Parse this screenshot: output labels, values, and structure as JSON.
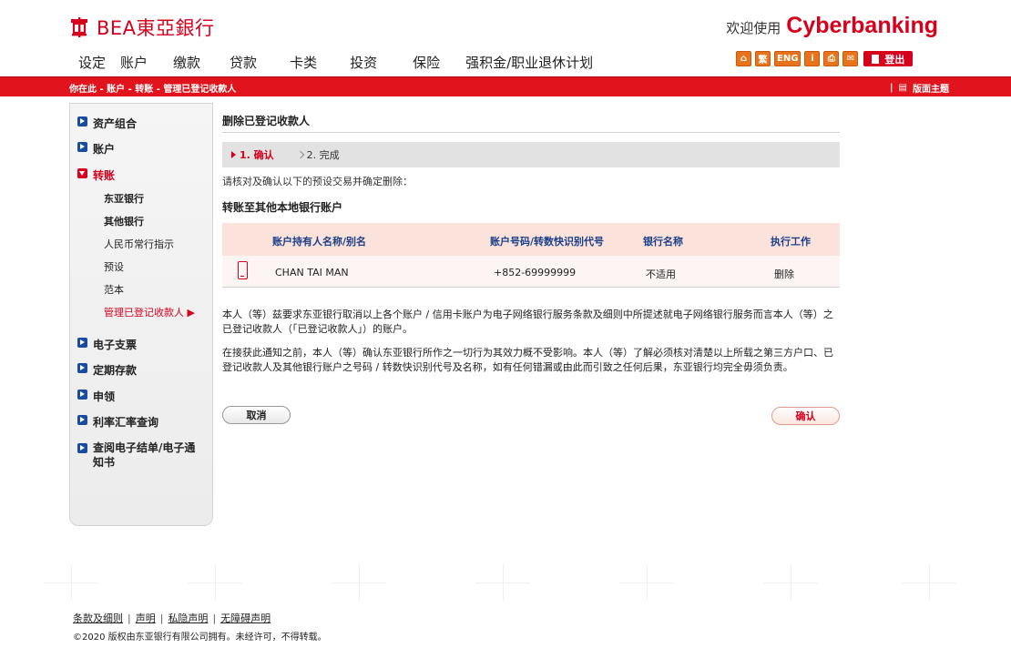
{
  "header": {
    "logo_text": "BEA東亞銀行",
    "welcome": "欢迎使用",
    "brand": "Cyberbanking"
  },
  "topnav": [
    "设定",
    "账户",
    "缴款",
    "贷款",
    "卡类",
    "投资",
    "保险",
    "强积金/职业退休计划"
  ],
  "tool_icons": [
    {
      "name": "home-icon",
      "label": "⌂"
    },
    {
      "name": "traditional-chinese-icon",
      "label": "繁"
    },
    {
      "name": "english-icon",
      "label": "ENG"
    },
    {
      "name": "info-icon",
      "label": "i"
    },
    {
      "name": "print-icon",
      "label": "⎙"
    },
    {
      "name": "mail-icon",
      "label": "✉"
    }
  ],
  "logout_label": "登出",
  "breadcrumb": "你在此 - 账户 - 转账 - 管理已登记收款人",
  "theme_label": "版面主题",
  "sidebar": {
    "items": [
      {
        "label": "资产组合"
      },
      {
        "label": "账户"
      },
      {
        "label": "转账"
      },
      {
        "label": "电子支票"
      },
      {
        "label": "定期存款"
      },
      {
        "label": "申领"
      },
      {
        "label": "利率汇率查询"
      },
      {
        "label": "查阅电子结单/电子通知书"
      }
    ],
    "subitems": [
      {
        "label": "东亚银行"
      },
      {
        "label": "其他银行"
      },
      {
        "label": "人民币常行指示"
      },
      {
        "label": "预设"
      },
      {
        "label": "范本"
      },
      {
        "label": "管理已登记收款人 ▶"
      }
    ]
  },
  "main": {
    "title": "删除已登记收款人",
    "step1": "1. 确认",
    "step2": "2. 完成",
    "instruction": "请核对及确认以下的预设交易并确定删除：",
    "section_title": "转账至其他本地银行账户",
    "table": {
      "headers": [
        "账户持有人名称/别名",
        "账户号码/转数快识别代号",
        "银行名称",
        "执行工作"
      ],
      "row": {
        "name": "CHAN TAI MAN",
        "account": "+852-69999999",
        "bank": "不适用",
        "action": "删除"
      }
    },
    "para1": "本人（等）兹要求东亚银行取消以上各个账户 / 信用卡账户为电子网络银行服务条款及细则中所提述就电子网络银行服务而言本人（等）之已登记收款人（「已登记收款人」）的账户。",
    "para2": "在接获此通知之前，本人（等）确认东亚银行所作之一切行为其效力概不受影响。本人（等）了解必须核对清楚以上所载之第三方户口、已登记收款人及其他银行账户之号码 / 转数快识别代号及名称，如有任何错漏或由此而引致之任何后果，东亚银行均完全毋须负责。",
    "cancel_label": "取消",
    "confirm_label": "确认"
  },
  "footer": {
    "links": [
      "条款及细则",
      "声明",
      "私隐声明",
      "无障碍声明"
    ],
    "copyright": "©2020 版权由东亚银行有限公司拥有。未经许可，不得转载。"
  }
}
